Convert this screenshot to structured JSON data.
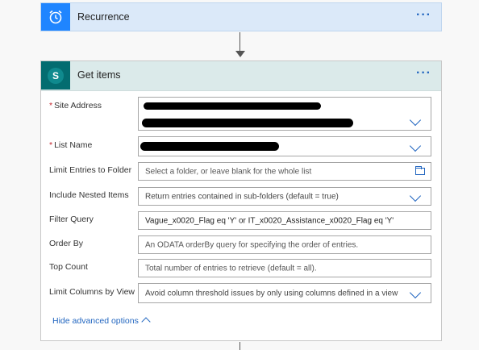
{
  "recurrence": {
    "title": "Recurrence",
    "more": "···",
    "icon": "alarm-clock-icon"
  },
  "get_items": {
    "title": "Get items",
    "more": "···",
    "icon": "sharepoint-icon",
    "required_marker": "*",
    "fields": {
      "site_address": {
        "label": "Site Address"
      },
      "list_name": {
        "label": "List Name"
      },
      "limit_entries": {
        "label": "Limit Entries to Folder",
        "placeholder": "Select a folder, or leave blank for the whole list"
      },
      "include_nested": {
        "label": "Include Nested Items",
        "value": "Return entries contained in sub-folders (default = true)"
      },
      "filter_query": {
        "label": "Filter Query",
        "value": "Vague_x0020_Flag eq 'Y' or IT_x0020_Assistance_x0020_Flag eq 'Y'"
      },
      "order_by": {
        "label": "Order By",
        "placeholder": "An ODATA orderBy query for specifying the order of entries."
      },
      "top_count": {
        "label": "Top Count",
        "placeholder": "Total number of entries to retrieve (default = all)."
      },
      "limit_columns": {
        "label": "Limit Columns by View",
        "value": "Avoid column threshold issues by only using columns defined in a view"
      }
    },
    "hide_advanced": "Hide advanced options"
  },
  "colors": {
    "accent": "#2266c0",
    "recurrence_icon_bg": "#1f85ff",
    "sharepoint_icon_bg": "#036c70",
    "required": "#c4262e"
  }
}
